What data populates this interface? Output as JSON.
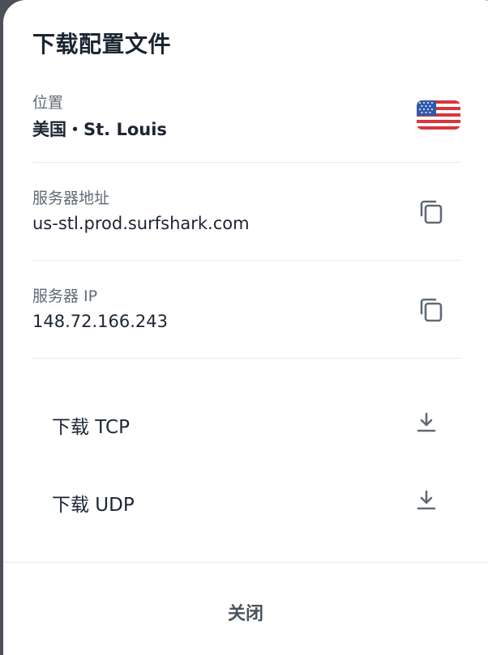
{
  "dialog": {
    "title": "下载配置文件",
    "location": {
      "label": "位置",
      "value": "美国・St. Louis",
      "flag_icon": "us-flag-icon"
    },
    "server_address": {
      "label": "服务器地址",
      "value": "us-stl.prod.surfshark.com",
      "action_icon": "copy-icon"
    },
    "server_ip": {
      "label": "服务器 IP",
      "value": "148.72.166.243",
      "action_icon": "copy-icon"
    },
    "downloads": [
      {
        "label": "下载 TCP",
        "icon": "download-icon"
      },
      {
        "label": "下载 UDP",
        "icon": "download-icon"
      }
    ],
    "close_label": "关闭"
  },
  "colors": {
    "text_primary": "#1c2533",
    "text_secondary": "#5f6b76",
    "icon": "#5f6b76",
    "divider": "#e6e9ec",
    "backdrop": "#4b5157"
  }
}
